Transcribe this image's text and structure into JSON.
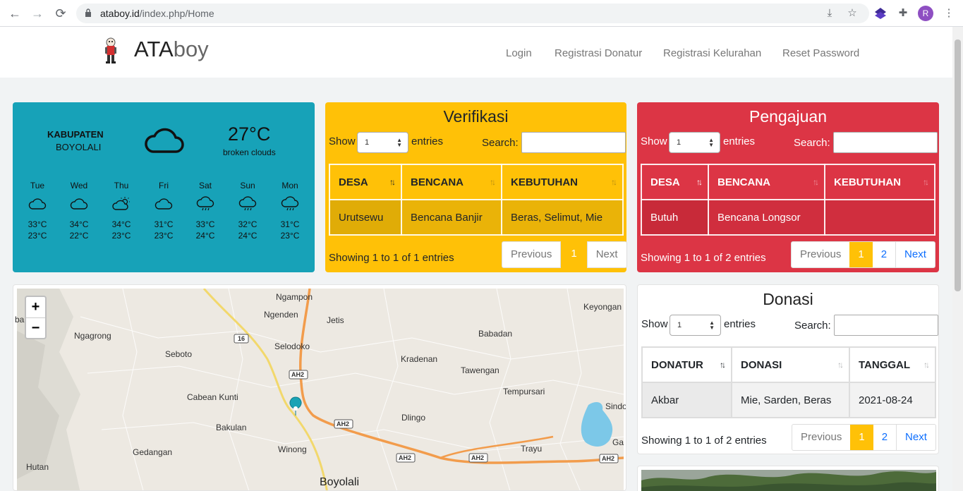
{
  "browser": {
    "url_host": "ataboy.id",
    "url_path": "/index.php/Home",
    "profile_initial": "R"
  },
  "header": {
    "brand_bold": "ATA",
    "brand_light": "boy",
    "nav": [
      "Login",
      "Registrasi Donatur",
      "Registrasi Kelurahan",
      "Reset Password"
    ]
  },
  "weather": {
    "location_line1": "KABUPATEN",
    "location_line2": "BOYOLALI",
    "temperature": "27°C",
    "description": "broken clouds",
    "days": [
      {
        "name": "Tue",
        "icon": "cloud-icon",
        "hi": "33°C",
        "lo": "23°C"
      },
      {
        "name": "Wed",
        "icon": "cloud-icon",
        "hi": "34°C",
        "lo": "22°C"
      },
      {
        "name": "Thu",
        "icon": "partly-sunny-icon",
        "hi": "34°C",
        "lo": "23°C"
      },
      {
        "name": "Fri",
        "icon": "cloud-icon",
        "hi": "31°C",
        "lo": "23°C"
      },
      {
        "name": "Sat",
        "icon": "rain-cloud-icon",
        "hi": "33°C",
        "lo": "24°C"
      },
      {
        "name": "Sun",
        "icon": "rain-cloud-icon",
        "hi": "32°C",
        "lo": "24°C"
      },
      {
        "name": "Mon",
        "icon": "rain-cloud-icon",
        "hi": "31°C",
        "lo": "23°C"
      }
    ]
  },
  "common": {
    "show": "Show",
    "entries": "entries",
    "search": "Search:",
    "length_value": "1",
    "previous": "Previous",
    "next": "Next"
  },
  "verifikasi": {
    "title": "Verifikasi",
    "columns": [
      "DESA",
      "BENCANA",
      "KEBUTUHAN"
    ],
    "rows": [
      [
        "Urutsewu",
        "Bencana Banjir",
        "Beras, Selimut, Mie"
      ]
    ],
    "info": "Showing 1 to 1 of 1 entries",
    "pages": [
      "1"
    ]
  },
  "pengajuan": {
    "title": "Pengajuan",
    "columns": [
      "DESA",
      "BENCANA",
      "KEBUTUHAN"
    ],
    "rows": [
      [
        "Butuh",
        "Bencana Longsor",
        ""
      ]
    ],
    "info": "Showing 1 to 1 of 2 entries",
    "pages": [
      "1",
      "2"
    ]
  },
  "donasi": {
    "title": "Donasi",
    "columns": [
      "DONATUR",
      "DONASI",
      "TANGGAL"
    ],
    "rows": [
      [
        "Akbar",
        "Mie, Sarden, Beras",
        "2021-08-24"
      ]
    ],
    "info": "Showing 1 to 1 of 2 entries",
    "pages": [
      "1",
      "2"
    ]
  },
  "map": {
    "zoom_in": "+",
    "zoom_out": "−",
    "places": [
      "Ngampon",
      "Ngenden",
      "Jetis",
      "Keyongan",
      "Ngagrong",
      "Babadan",
      "Selodoko",
      "Seboto",
      "Kradenan",
      "Tawengan",
      "Tempursari",
      "Cabean Kunti",
      "Sindo",
      "Dlingo",
      "Bakulan",
      "Gedangan",
      "Winong",
      "Trayu",
      "Hutan",
      "Boyolali",
      "Ga",
      "ba"
    ],
    "road_labels": [
      "16",
      "AH2",
      "AH2",
      "AH2",
      "AH2",
      "AH2"
    ]
  },
  "colors": {
    "weather_bg": "#17a2b8",
    "verifikasi_bg": "#ffc107",
    "pengajuan_bg": "#dc3545",
    "pagination_active": "#ffc107",
    "link": "#0d6efd"
  }
}
